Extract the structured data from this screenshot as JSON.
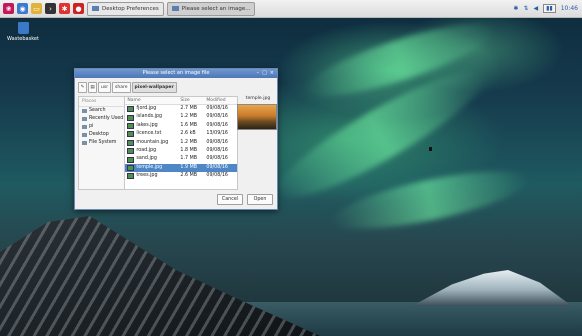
{
  "taskbar": {
    "tasks": [
      {
        "label": "Desktop Preferences"
      },
      {
        "label": "Please select an image..."
      }
    ],
    "clock": "10:46"
  },
  "desktop": {
    "icons": [
      {
        "label": "Wastebasket"
      }
    ]
  },
  "dialog": {
    "title": "Please select an image file",
    "path": [
      "usr",
      "share",
      "pixel-wallpaper"
    ],
    "places_header": "Places",
    "places": [
      "Search",
      "Recently Used",
      "pi",
      "Desktop",
      "File System"
    ],
    "columns": {
      "name": "Name",
      "size": "Size",
      "modified": "Modified"
    },
    "files": [
      {
        "name": "fjord.jpg",
        "size": "2.7 MB",
        "modified": "09/08/16",
        "selected": false
      },
      {
        "name": "islands.jpg",
        "size": "1.2 MB",
        "modified": "09/08/16",
        "selected": false
      },
      {
        "name": "lakes.jpg",
        "size": "1.6 MB",
        "modified": "09/08/16",
        "selected": false
      },
      {
        "name": "licence.txt",
        "size": "2.6 kB",
        "modified": "13/09/16",
        "selected": false
      },
      {
        "name": "mountain.jpg",
        "size": "1.2 MB",
        "modified": "09/08/16",
        "selected": false
      },
      {
        "name": "road.jpg",
        "size": "1.8 MB",
        "modified": "09/08/16",
        "selected": false
      },
      {
        "name": "sand.jpg",
        "size": "1.7 MB",
        "modified": "09/08/16",
        "selected": false
      },
      {
        "name": "temple.jpg",
        "size": "1.9 MB",
        "modified": "09/08/16",
        "selected": true
      },
      {
        "name": "trees.jpg",
        "size": "2.6 MB",
        "modified": "09/08/16",
        "selected": false
      }
    ],
    "preview": {
      "filename": "temple.jpg"
    },
    "buttons": {
      "cancel": "Cancel",
      "open": "Open"
    }
  },
  "colors": {
    "accent": "#4f86c6",
    "titlebar": "#5b84c0"
  }
}
